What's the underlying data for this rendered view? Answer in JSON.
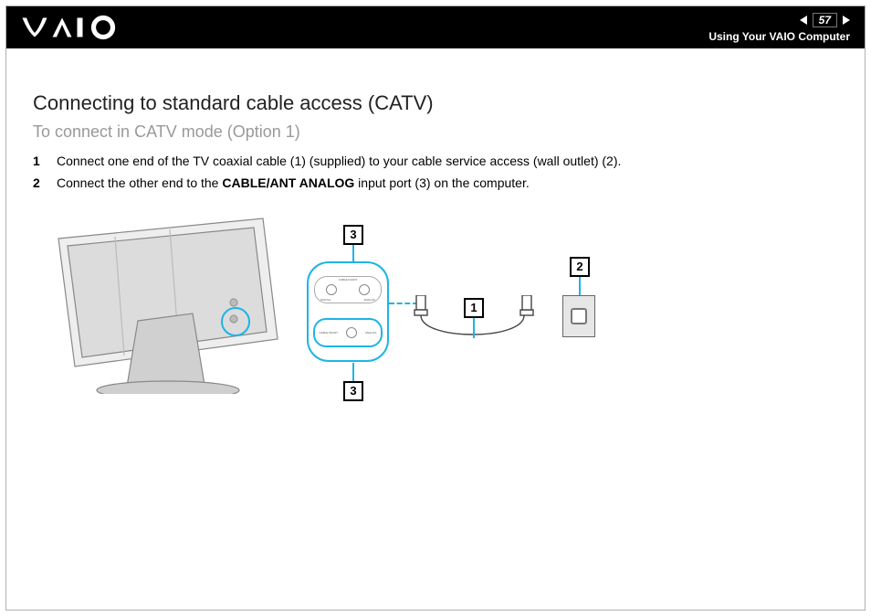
{
  "header": {
    "page_number": "57",
    "section": "Using Your VAIO Computer",
    "logo_alt": "VAIO"
  },
  "main": {
    "heading": "Connecting to standard cable access (CATV)",
    "subheading": "To connect in CATV mode (Option 1)",
    "steps": [
      {
        "num": "1",
        "text_before": "Connect one end of the TV coaxial cable (1) (supplied) to your cable service access (wall outlet) (2).",
        "bold": "",
        "text_after": ""
      },
      {
        "num": "2",
        "text_before": "Connect the other end to the ",
        "bold": "CABLE/ANT ANALOG",
        "text_after": " input port (3) on the computer."
      }
    ]
  },
  "diagram": {
    "port_panel_labels": {
      "top_left": "CABLE IN/ANT",
      "top_section_left": "DIGITAL",
      "top_section_right": "ANALOG",
      "bottom_left": "CABLE IN/ANT",
      "bottom_right": "ANALOG"
    },
    "callouts": {
      "cable": "1",
      "wall_outlet": "2",
      "input_port_top": "3",
      "input_port_bottom": "3"
    }
  }
}
